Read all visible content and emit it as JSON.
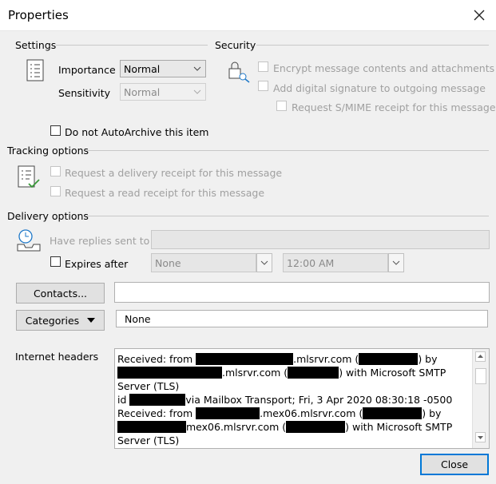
{
  "window": {
    "title": "Properties"
  },
  "settings": {
    "heading": "Settings",
    "importance_label": "Importance",
    "importance_value": "Normal",
    "sensitivity_label": "Sensitivity",
    "sensitivity_value": "Normal",
    "autoarchive_label": "Do not AutoArchive this item"
  },
  "security": {
    "heading": "Security",
    "encrypt_label": "Encrypt message contents and attachments",
    "signature_label": "Add digital signature to outgoing message",
    "smime_label": "Request S/MIME receipt for this message"
  },
  "tracking": {
    "heading": "Tracking options",
    "delivery_receipt_label": "Request a delivery receipt for this message",
    "read_receipt_label": "Request a read receipt for this message"
  },
  "delivery": {
    "heading": "Delivery options",
    "replies_label": "Have replies sent to",
    "replies_value": "",
    "expires_label": "Expires after",
    "expires_date": "None",
    "expires_time": "12:00 AM"
  },
  "contacts": {
    "button_label": "Contacts...",
    "value": ""
  },
  "categories": {
    "button_label": "Categories",
    "value": "None"
  },
  "internet_headers": {
    "label": "Internet headers",
    "lines": [
      {
        "pre": "Received: from ",
        "mid1": ".mlsrvr.com (",
        "mid2": ") by"
      },
      {
        "pre": "",
        "mid1": ".mlsrvr.com (",
        "mid2": ") with Microsoft SMTP"
      },
      {
        "pre": "Server (TLS)"
      },
      {
        "pre": " id ",
        "mid1": "via Mailbox Transport; Fri, 3 Apr 2020 08:30:18 -0500"
      },
      {
        "pre": "Received: from ",
        "mid1": ".mex06.mlsrvr.com (",
        "mid2": ") by"
      },
      {
        "pre": "",
        "mid1": "mex06.mlsrvr.com (",
        "mid2": ") with Microsoft SMTP"
      },
      {
        "pre": "Server (TLS)"
      }
    ]
  },
  "footer": {
    "close_label": "Close"
  }
}
